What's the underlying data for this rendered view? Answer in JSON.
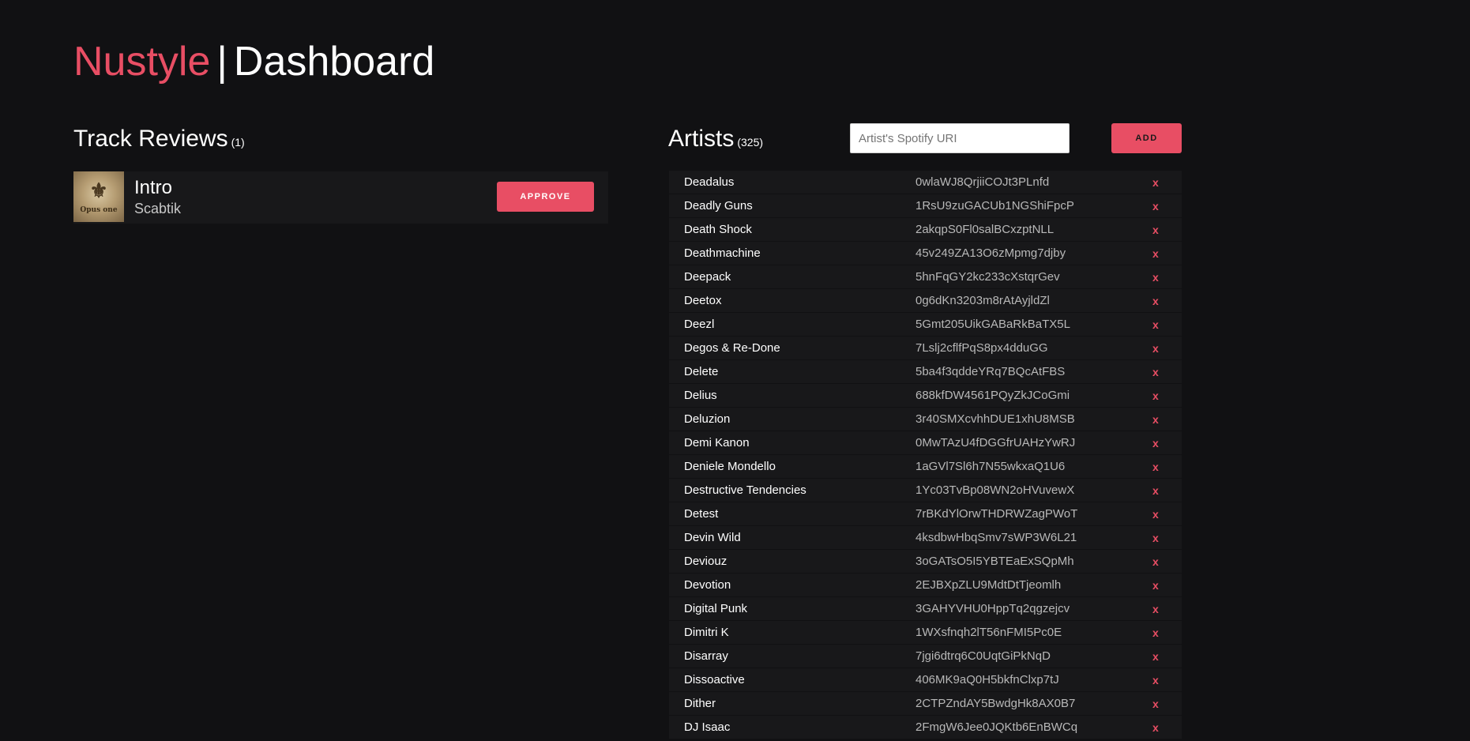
{
  "header": {
    "brand": "Nustyle",
    "separator": "|",
    "title": "Dashboard"
  },
  "reviews": {
    "heading": "Track Reviews",
    "count": "(1)",
    "items": [
      {
        "title": "Intro",
        "artist": "Scabtik",
        "cover_mark": "⚜",
        "cover_text": "Opus one",
        "approve_label": "APPROVE"
      }
    ]
  },
  "artists": {
    "heading": "Artists",
    "count": "(325)",
    "input_placeholder": "Artist's Spotify URI",
    "add_label": "ADD",
    "delete_label": "x",
    "rows": [
      {
        "name": "Deadalus",
        "uri": "0wlaWJ8QrjiiCOJt3PLnfd"
      },
      {
        "name": "Deadly Guns",
        "uri": "1RsU9zuGACUb1NGShiFpcP"
      },
      {
        "name": "Death Shock",
        "uri": "2akqpS0Fl0salBCxzptNLL"
      },
      {
        "name": "Deathmachine",
        "uri": "45v249ZA13O6zMpmg7djby"
      },
      {
        "name": "Deepack",
        "uri": "5hnFqGY2kc233cXstqrGev"
      },
      {
        "name": "Deetox",
        "uri": "0g6dKn3203m8rAtAyjldZl"
      },
      {
        "name": "Deezl",
        "uri": "5Gmt205UikGABaRkBaTX5L"
      },
      {
        "name": "Degos & Re-Done",
        "uri": "7Lslj2cflfPqS8px4dduGG"
      },
      {
        "name": "Delete",
        "uri": "5ba4f3qddeYRq7BQcAtFBS"
      },
      {
        "name": "Delius",
        "uri": "688kfDW4561PQyZkJCoGmi"
      },
      {
        "name": "Deluzion",
        "uri": "3r40SMXcvhhDUE1xhU8MSB"
      },
      {
        "name": "Demi Kanon",
        "uri": "0MwTAzU4fDGGfrUAHzYwRJ"
      },
      {
        "name": "Deniele Mondello",
        "uri": "1aGVl7Sl6h7N55wkxaQ1U6"
      },
      {
        "name": "Destructive Tendencies",
        "uri": "1Yc03TvBp08WN2oHVuvewX"
      },
      {
        "name": "Detest",
        "uri": "7rBKdYlOrwTHDRWZagPWoT"
      },
      {
        "name": "Devin Wild",
        "uri": "4ksdbwHbqSmv7sWP3W6L21"
      },
      {
        "name": "Deviouz",
        "uri": "3oGATsO5I5YBTEaExSQpMh"
      },
      {
        "name": "Devotion",
        "uri": "2EJBXpZLU9MdtDtTjeomlh"
      },
      {
        "name": "Digital Punk",
        "uri": "3GAHYVHU0HppTq2qgzejcv"
      },
      {
        "name": "Dimitri K",
        "uri": "1WXsfnqh2lT56nFMI5Pc0E"
      },
      {
        "name": "Disarray",
        "uri": "7jgi6dtrq6C0UqtGiPkNqD"
      },
      {
        "name": "Dissoactive",
        "uri": "406MK9aQ0H5bkfnClxp7tJ"
      },
      {
        "name": "Dither",
        "uri": "2CTPZndAY5BwdgHk8AX0B7"
      },
      {
        "name": "DJ Isaac",
        "uri": "2FmgW6Jee0JQKtb6EnBWCq"
      }
    ]
  },
  "colors": {
    "background": "#111113",
    "accent": "#e84e64",
    "row_background": "#18181a"
  }
}
